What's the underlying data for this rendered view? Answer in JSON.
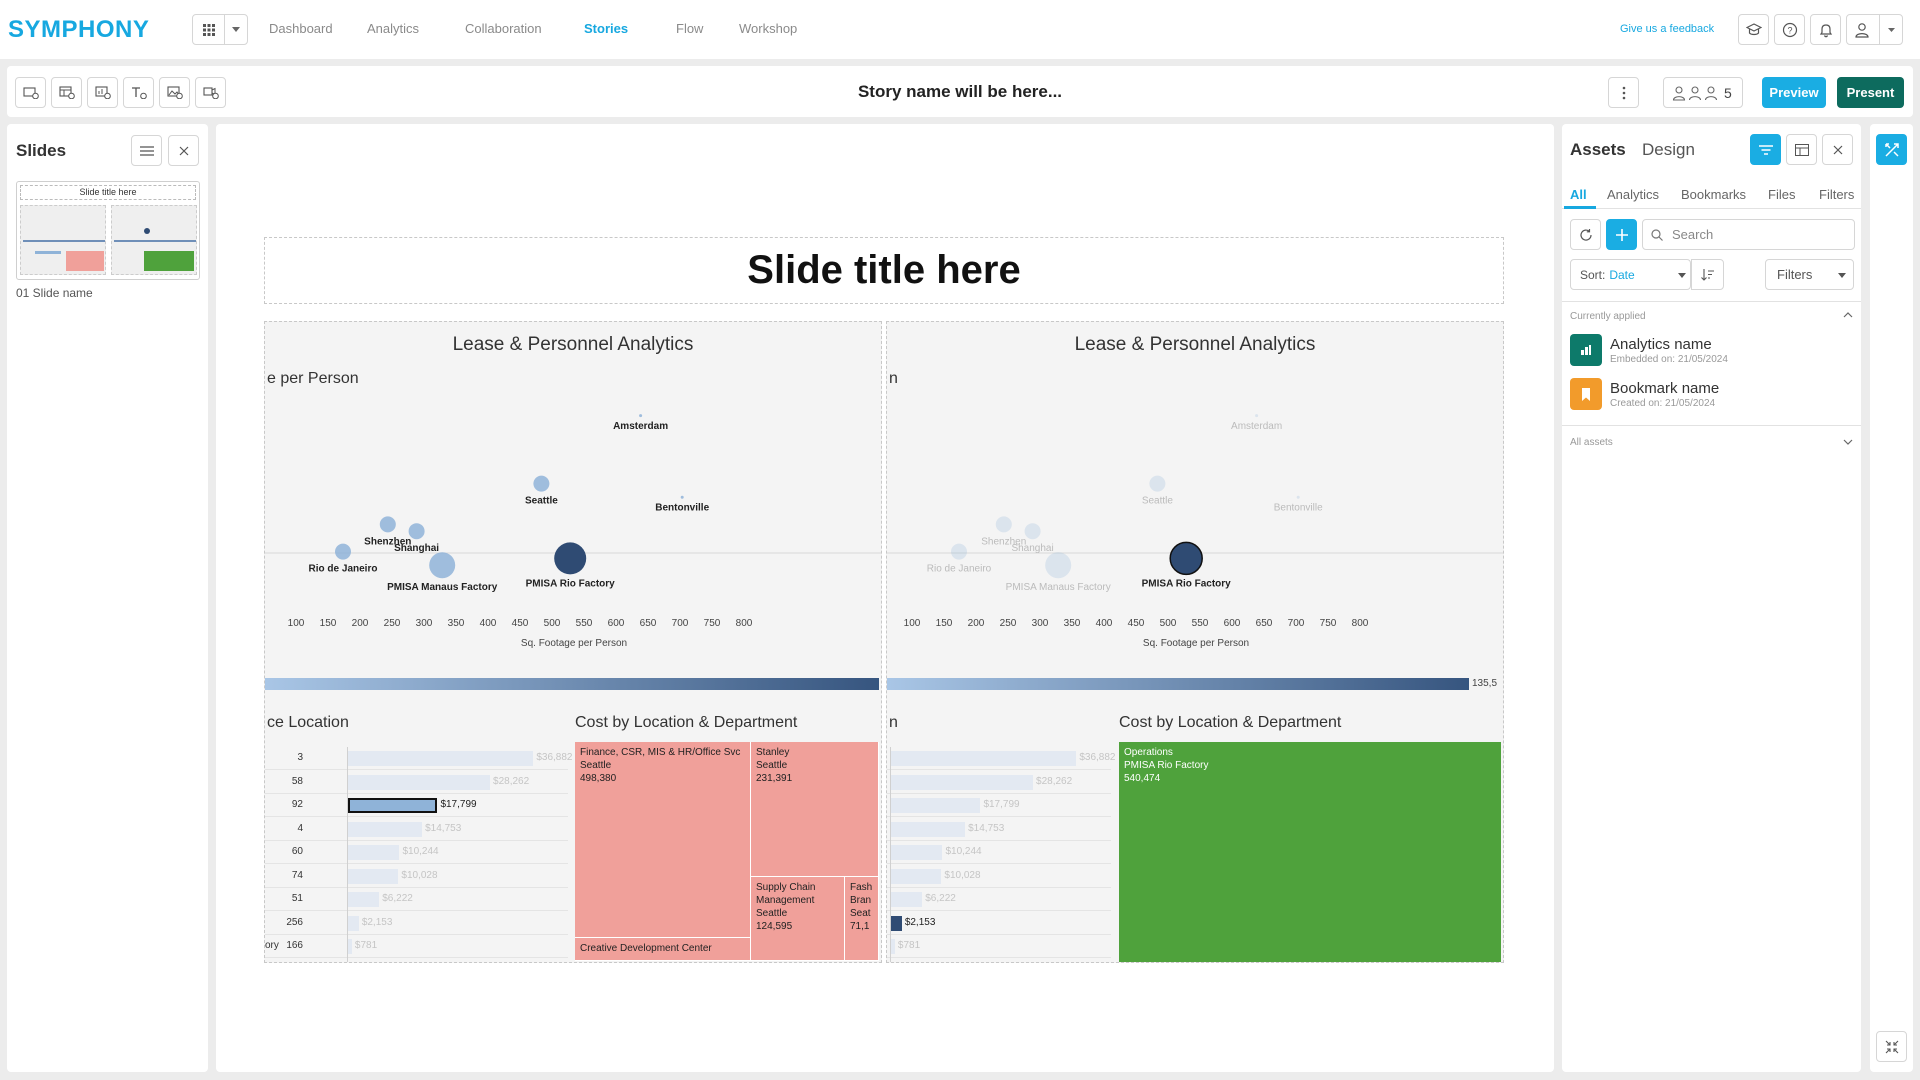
{
  "app": {
    "logo": "SYMPHONY"
  },
  "nav": {
    "links": [
      "Dashboard",
      "Analytics",
      "Collaboration",
      "Stories",
      "Flow",
      "Workshop"
    ],
    "active": "Stories",
    "feedback": "Give us a feedback"
  },
  "toolbar": {
    "story_name": "Story name will be here...",
    "user_count": "5",
    "preview_label": "Preview",
    "present_label": "Present"
  },
  "slides_panel": {
    "title": "Slides",
    "thumb_title": "Slide title here",
    "slide_label": "01 Slide name"
  },
  "slide": {
    "title": "Slide title here",
    "viz_left": {
      "title": "Lease & Personnel Analytics",
      "scatter_heading": "e per Person",
      "bar_heading": "ce Location",
      "treemap_heading": "Cost by Location & Department"
    },
    "viz_right": {
      "title": "Lease & Personnel Analytics",
      "scatter_heading": "n",
      "bar_heading": "n",
      "treemap_heading": "Cost by Location & Department",
      "color_bar_value": "135,5"
    }
  },
  "chart_data": [
    {
      "type": "scatter",
      "xlabel": "Sq. Footage per Person",
      "x_ticks": [
        100,
        150,
        200,
        250,
        300,
        350,
        400,
        450,
        500,
        550,
        600,
        650,
        700,
        750,
        800
      ],
      "points": [
        {
          "label": "Amsterdam",
          "x": 640,
          "y": 1
        },
        {
          "label": "Seattle",
          "x": 485,
          "y": 2
        },
        {
          "label": "Bentonville",
          "x": 705,
          "y": 2.2
        },
        {
          "label": "Shenzhen",
          "x": 245,
          "y": 2.6
        },
        {
          "label": "Shanghai",
          "x": 290,
          "y": 2.7
        },
        {
          "label": "Rio de Janeiro",
          "x": 175,
          "y": 3
        },
        {
          "label": "PMISA Manaus Factory",
          "x": 330,
          "y": 3.2
        },
        {
          "label": "PMISA Rio Factory",
          "x": 530,
          "y": 3.1
        }
      ]
    },
    {
      "type": "bar",
      "rows": [
        {
          "label": "3",
          "value": 36882,
          "text": "$36,882"
        },
        {
          "label": "58",
          "value": 28262,
          "text": "$28,262"
        },
        {
          "label": "92",
          "value": 17799,
          "text": "$17,799"
        },
        {
          "label": "4",
          "value": 14753,
          "text": "$14,753"
        },
        {
          "label": "60",
          "value": 10244,
          "text": "$10,244"
        },
        {
          "label": "74",
          "value": 10028,
          "text": "$10,028"
        },
        {
          "label": "51",
          "value": 6222,
          "text": "$6,222"
        },
        {
          "label": "256",
          "value": 2153,
          "text": "$2,153"
        },
        {
          "label": "166",
          "value": 781,
          "text": "$781"
        }
      ],
      "highlight_left": 2,
      "highlight_right": 7,
      "row_prefix_left_last": "ory"
    },
    {
      "type": "treemap",
      "left_cells": [
        {
          "lines": [
            "Finance, CSR, MIS & HR/Office Svc",
            "Seattle",
            "498,380"
          ]
        },
        {
          "lines": [
            "Stanley",
            "Seattle",
            "231,391"
          ]
        },
        {
          "lines": [
            "Supply Chain",
            "Management",
            "Seattle",
            "124,595"
          ]
        },
        {
          "lines": [
            "Fash",
            "Bran",
            "Seat",
            "71,1"
          ]
        },
        {
          "lines": [
            "Creative Development Center"
          ]
        }
      ],
      "right_cells": [
        {
          "lines": [
            "Operations",
            "PMISA Rio Factory",
            "540,474"
          ]
        }
      ]
    }
  ],
  "right_panel": {
    "tab_assets": "Assets",
    "tab_design": "Design",
    "subtabs": [
      "All",
      "Analytics",
      "Bookmarks",
      "Files",
      "Filters"
    ],
    "search_placeholder": "Search",
    "sort_prefix": "Sort:",
    "sort_value": "Date",
    "filters_label": "Filters",
    "currently_applied": "Currently applied",
    "all_assets": "All assets",
    "assets": [
      {
        "name": "Analytics name",
        "meta": "Embedded on: 21/05/2024",
        "color": "#0d7a6a"
      },
      {
        "name": "Bookmark name",
        "meta": "Created on: 21/05/2024",
        "color": "#f29b2b"
      }
    ]
  },
  "colors": {
    "brand": "#17a8e0",
    "present": "#0d6b5e",
    "treemap_red": "#f0a09a",
    "treemap_green": "#4fa23c",
    "bubble_dark": "#2f4b73",
    "bubble_light": "#8fb3d8"
  }
}
